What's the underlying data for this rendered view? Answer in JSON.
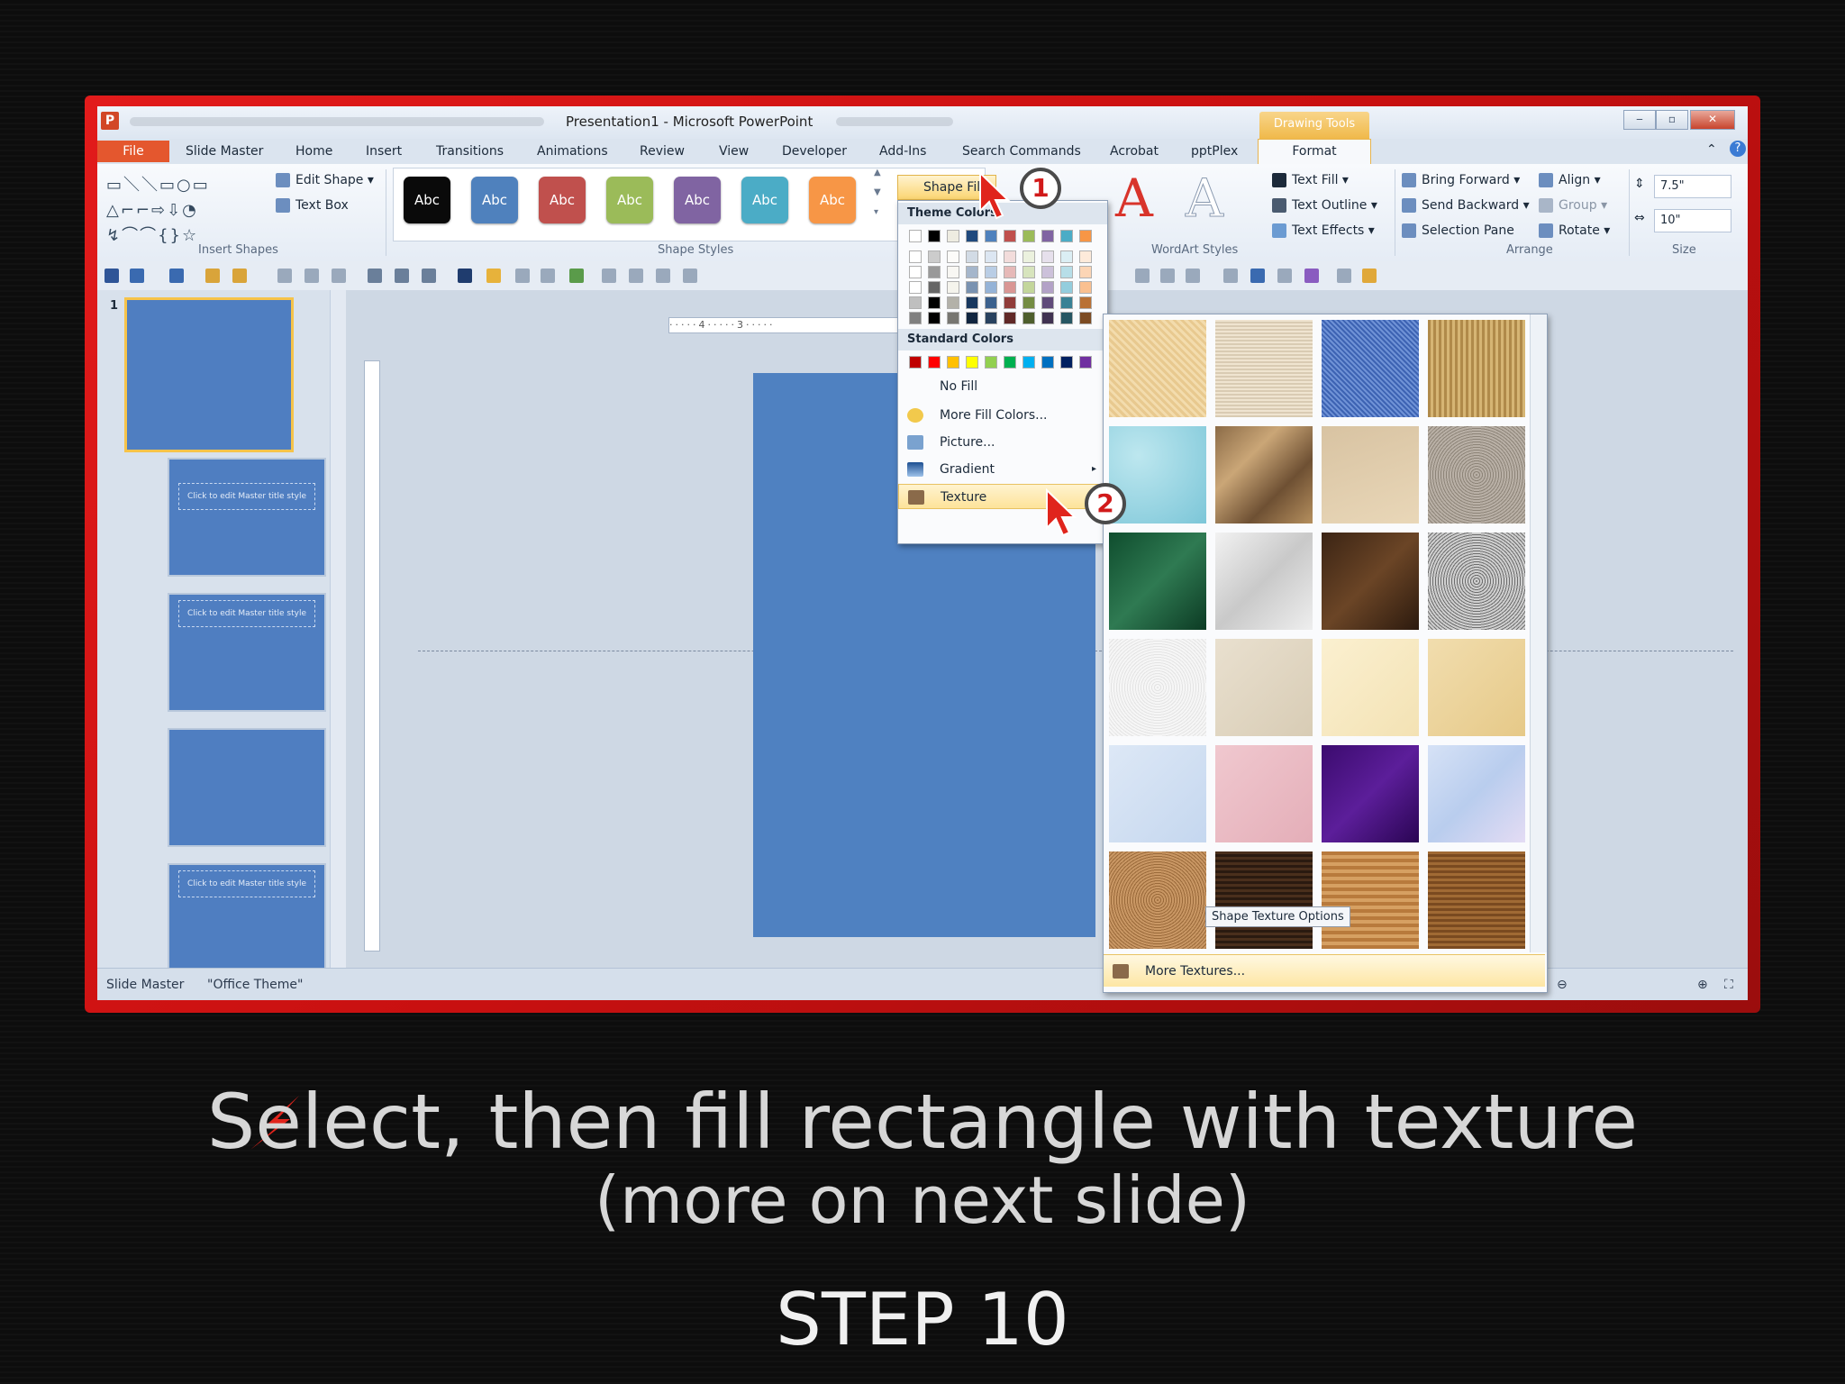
{
  "window": {
    "title": "Presentation1 - Microsoft PowerPoint",
    "app_icon": "P",
    "contextual_tab": "Drawing Tools",
    "controls": [
      "‒",
      "▫",
      "✕"
    ]
  },
  "tabs": [
    "File",
    "Slide Master",
    "Home",
    "Insert",
    "Transitions",
    "Animations",
    "Review",
    "View",
    "Developer",
    "Add-Ins",
    "Search Commands",
    "Acrobat",
    "pptPlex",
    "Format"
  ],
  "ribbon": {
    "insert_shapes": {
      "edit_shape": "Edit Shape",
      "text_box": "Text Box",
      "label": "Insert Shapes"
    },
    "shape_styles": {
      "swatch_text": "Abc",
      "label": "Shape Styles",
      "colors": [
        "#0a0a0a",
        "#4f81bd",
        "#c0504d",
        "#9bbb59",
        "#8064a2",
        "#4bacc6",
        "#f79646"
      ]
    },
    "shape_fill": "Shape Fill",
    "wordart": {
      "text_fill": "Text Fill",
      "text_outline": "Text Outline",
      "text_effects": "Text Effects",
      "label": "WordArt Styles",
      "sample": "A"
    },
    "arrange": {
      "bring_forward": "Bring Forward",
      "send_backward": "Send Backward",
      "selection_pane": "Selection Pane",
      "align": "Align",
      "group": "Group",
      "rotate": "Rotate",
      "label": "Arrange"
    },
    "size": {
      "height": "7.5\"",
      "width": "10\"",
      "label": "Size"
    }
  },
  "fill_menu": {
    "theme_colors_header": "Theme Colors",
    "standard_colors_header": "Standard Colors",
    "standard_colors": [
      "#c00000",
      "#ff0000",
      "#ffc000",
      "#ffff00",
      "#92d050",
      "#00b050",
      "#00b0f0",
      "#0070c0",
      "#002060",
      "#7030a0"
    ],
    "no_fill": "No Fill",
    "more_fill_colors": "More Fill Colors...",
    "picture": "Picture...",
    "gradient": "Gradient",
    "texture": "Texture"
  },
  "texture_gallery": {
    "more_textures": "More Textures...",
    "tooltip": "Shape Texture Options"
  },
  "status_bar": {
    "view": "Slide Master",
    "theme": "\"Office Theme\""
  },
  "thumbnails": {
    "slide_number": "1",
    "title_placeholder": "Click to edit Master title style"
  },
  "callouts": [
    "1",
    "2"
  ],
  "caption": {
    "line1": "Select, then fill rectangle with texture",
    "line2": "(more on next slide)",
    "step": "STEP 10"
  }
}
